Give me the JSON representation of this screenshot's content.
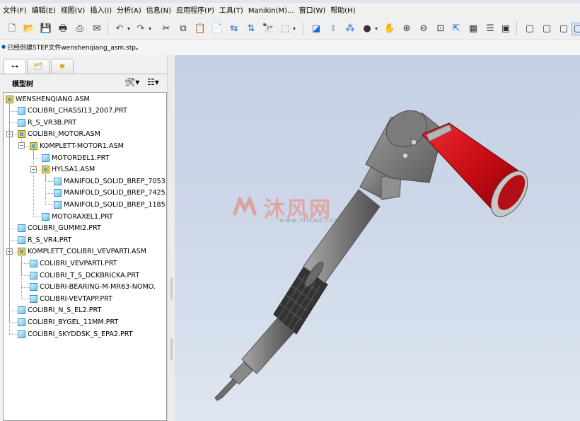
{
  "menu": [
    "文件(F)",
    "编辑(E)",
    "视图(V)",
    "插入(I)",
    "分析(A)",
    "信息(N)",
    "应用程序(P)",
    "工具(T)",
    "Manikin(M)...",
    "窗口(W)",
    "帮助(H)"
  ],
  "toolbar_icons": [
    "new-icon",
    "open-icon",
    "save-icon",
    "print-icon",
    "print-quick-icon",
    "email-icon",
    "undo-icon",
    "redo-icon",
    "cut-icon",
    "copy-icon",
    "paste-icon",
    "paste-special-icon",
    "regenerate-icon",
    "find-icon",
    "select-box-icon",
    "sketch-icon",
    "datum-icon",
    "csys-icon",
    "shading-icon",
    "spin-icon",
    "zoom-in-icon",
    "zoom-out-icon",
    "refit-icon",
    "orient-icon",
    "saved-views-icon",
    "layers-icon",
    "view-manager-icon",
    "wireframe-icon",
    "hidden-line-icon",
    "no-hidden-icon",
    "shaded-icon"
  ],
  "message": "已经创建STEP文件wenshenqiang_asm.stp。",
  "panel": {
    "title": "模型树",
    "tabs": [
      "model-tree-tab",
      "folder-browser-tab",
      "favorites-tab"
    ]
  },
  "tree": [
    {
      "label": "WENSHENQIANG.ASM",
      "type": "asm",
      "level": 0,
      "expanded": true
    },
    {
      "label": "COLIBRI_CHASSI13_2007.PRT",
      "type": "prt",
      "level": 1
    },
    {
      "label": "R_S_VR3B.PRT",
      "type": "prt",
      "level": 1
    },
    {
      "label": "COLIBRI_MOTOR.ASM",
      "type": "asm",
      "level": 1,
      "expanded": true
    },
    {
      "label": "KOMPLETT-MOTOR1.ASM",
      "type": "asm",
      "level": 2,
      "expanded": true
    },
    {
      "label": "MOTORDEL1.PRT",
      "type": "prt",
      "level": 3
    },
    {
      "label": "HYLSA1.ASM",
      "type": "asm",
      "level": 3,
      "expanded": true
    },
    {
      "label": "MANIFOLD_SOLID_BREP_7053",
      "type": "prt",
      "level": 4
    },
    {
      "label": "MANIFOLD_SOLID_BREP_7425",
      "type": "prt",
      "level": 4
    },
    {
      "label": "MANIFOLD_SOLID_BREP_1185",
      "type": "prt",
      "level": 4
    },
    {
      "label": "MOTORAXEL1.PRT",
      "type": "prt",
      "level": 3
    },
    {
      "label": "COLIBRI_GUMMI2.PRT",
      "type": "prt",
      "level": 1
    },
    {
      "label": "R_S_VR4.PRT",
      "type": "prt",
      "level": 1
    },
    {
      "label": "KOMPLETT_COLIBRI_VEVPARTI.ASM",
      "type": "asm",
      "level": 1,
      "expanded": true
    },
    {
      "label": "COLIBRI_VEVPARTI.PRT",
      "type": "prt",
      "level": 2
    },
    {
      "label": "COLIBRI_T_S_DCKBRICKA.PRT",
      "type": "prt",
      "level": 2
    },
    {
      "label": "COLIBRI-BEARING-M-MR63-NOMO.",
      "type": "prt",
      "level": 2
    },
    {
      "label": "COLIBRI-VEVTAPP.PRT",
      "type": "prt",
      "level": 2
    },
    {
      "label": "COLIBRI_N_S_EL2.PRT",
      "type": "prt",
      "level": 1
    },
    {
      "label": "COLIBRI_BYGEL_11MM.PRT",
      "type": "prt",
      "level": 1
    },
    {
      "label": "COLIBRI_SKYDDSK_S_EPA2.PRT",
      "type": "prt",
      "level": 1
    }
  ],
  "watermark": {
    "text": "沐风网",
    "url": "www.mfcad.com"
  },
  "colors": {
    "motor_red": "#d20f18",
    "body_gray": "#7d7d7d",
    "grip_dark": "#3a3a3a",
    "viewport_bg": "#cdd7e8"
  }
}
